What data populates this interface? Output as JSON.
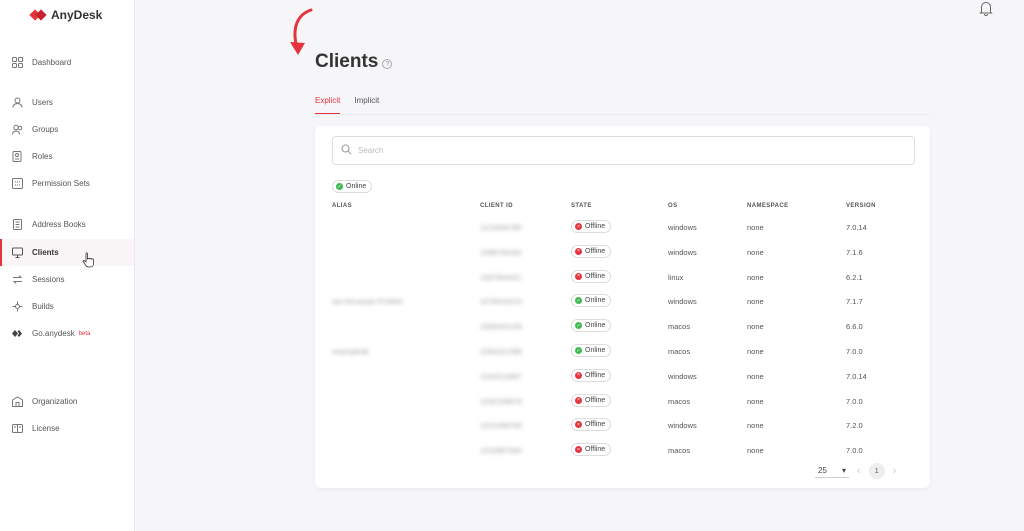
{
  "app": {
    "name": "AnyDesk"
  },
  "sidebar": {
    "items": [
      {
        "label": "Dashboard"
      },
      {
        "label": "Users"
      },
      {
        "label": "Groups"
      },
      {
        "label": "Roles"
      },
      {
        "label": "Permission Sets"
      },
      {
        "label": "Address Books"
      },
      {
        "label": "Clients"
      },
      {
        "label": "Sessions"
      },
      {
        "label": "Builds"
      },
      {
        "label": "Go.anydesk",
        "badge": "beta"
      },
      {
        "label": "Organization"
      },
      {
        "label": "License"
      }
    ]
  },
  "page": {
    "title": "Clients"
  },
  "tabs": [
    {
      "label": "Explicit"
    },
    {
      "label": "Implicit"
    }
  ],
  "search": {
    "placeholder": "Search"
  },
  "filter_chip": {
    "label": "Online"
  },
  "table": {
    "headers": [
      "ALIAS",
      "CLIENT ID",
      "STATE",
      "OS",
      "NAMESPACE",
      "VERSION"
    ],
    "rows": [
      {
        "alias": "",
        "client_id": "1123456789",
        "state": "Offline",
        "os": "windows",
        "namespace": "none",
        "version": "7.0.14"
      },
      {
        "alias": "",
        "client_id": "1098765432",
        "state": "Offline",
        "os": "windows",
        "namespace": "none",
        "version": "7.1.6"
      },
      {
        "alias": "",
        "client_id": "1087654321",
        "state": "Offline",
        "os": "linux",
        "namespace": "none",
        "version": "6.2.1"
      },
      {
        "alias": "win-fernando-PVM04",
        "client_id": "1076543210",
        "state": "Online",
        "os": "windows",
        "namespace": "none",
        "version": "7.1.7"
      },
      {
        "alias": "",
        "client_id": "1065432109",
        "state": "Online",
        "os": "macos",
        "namespace": "none",
        "version": "6.6.0"
      },
      {
        "alias": "exampleab",
        "client_id": "1054321098",
        "state": "Online",
        "os": "macos",
        "namespace": "none",
        "version": "7.0.0"
      },
      {
        "alias": "",
        "client_id": "1043210987",
        "state": "Offline",
        "os": "windows",
        "namespace": "none",
        "version": "7.0.14"
      },
      {
        "alias": "",
        "client_id": "1032109876",
        "state": "Offline",
        "os": "macos",
        "namespace": "none",
        "version": "7.0.0"
      },
      {
        "alias": "",
        "client_id": "1021098765",
        "state": "Offline",
        "os": "windows",
        "namespace": "none",
        "version": "7.2.0"
      },
      {
        "alias": "",
        "client_id": "1010987654",
        "state": "Offline",
        "os": "macos",
        "namespace": "none",
        "version": "7.0.0"
      }
    ]
  },
  "pagination": {
    "per_page": "25",
    "current_page": "1"
  },
  "colors": {
    "accent": "#e5343d",
    "online": "#3fb950",
    "offline": "#e5343d"
  }
}
